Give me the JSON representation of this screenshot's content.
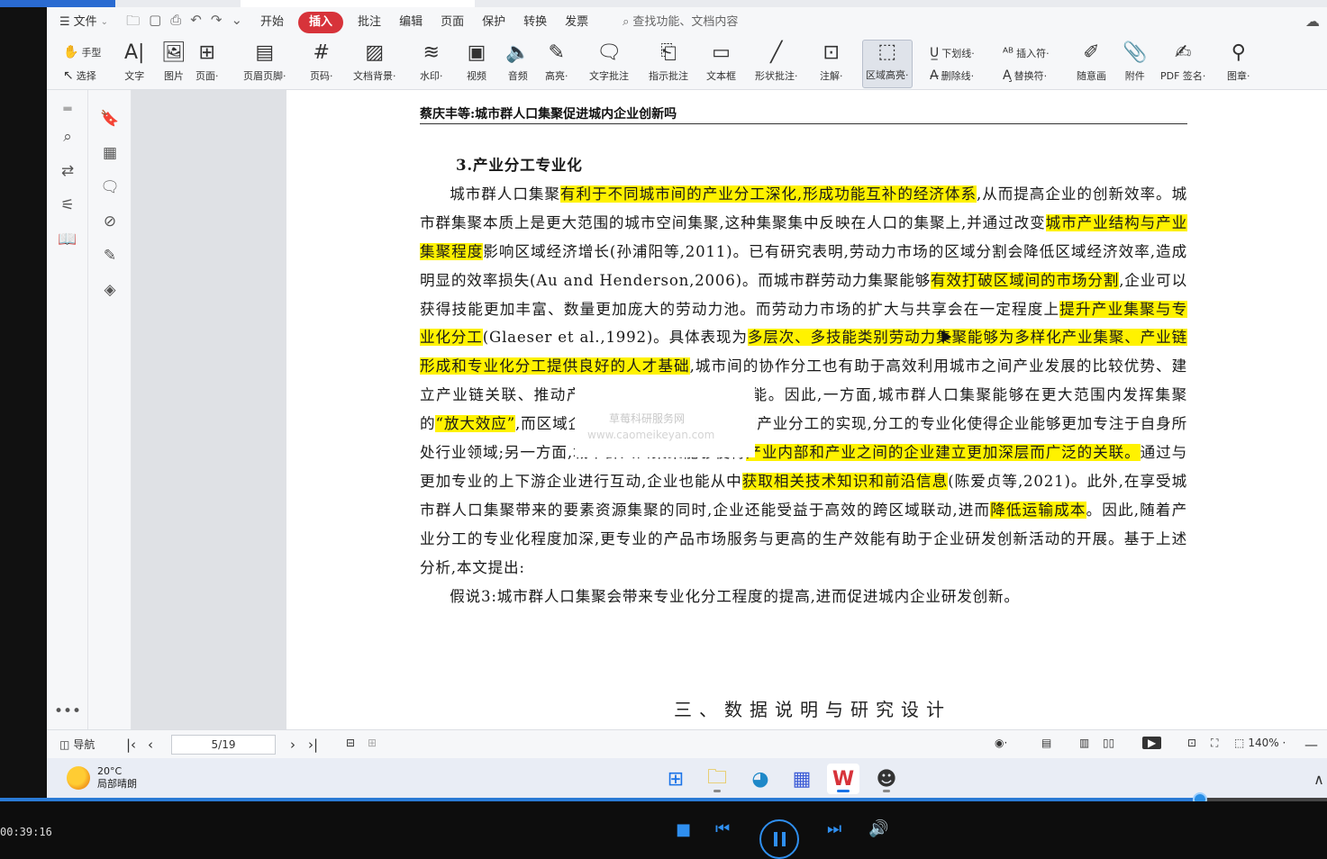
{
  "menubar": {
    "file": "文件",
    "tabs": [
      "开始",
      "插入",
      "批注",
      "编辑",
      "页面",
      "保护",
      "转换",
      "发票"
    ],
    "active_tab": "插入",
    "search_placeholder": "查找功能、文档内容"
  },
  "ribbon": {
    "hand": "手型",
    "select": "选择",
    "items": [
      {
        "label": "文字",
        "icon": "text-icon"
      },
      {
        "label": "图片",
        "icon": "image-icon"
      },
      {
        "label": "页面·",
        "icon": "page-icon"
      },
      {
        "label": "页眉页脚·",
        "icon": "header-footer-icon"
      },
      {
        "label": "页码·",
        "icon": "page-number-icon"
      },
      {
        "label": "文档背景·",
        "icon": "background-icon"
      },
      {
        "label": "水印·",
        "icon": "watermark-icon"
      },
      {
        "label": "视频",
        "icon": "video-icon"
      },
      {
        "label": "音频",
        "icon": "audio-icon"
      },
      {
        "label": "高亮·",
        "icon": "highlight-icon"
      },
      {
        "label": "文字批注",
        "icon": "text-comment-icon"
      },
      {
        "label": "指示批注",
        "icon": "pointer-comment-icon"
      },
      {
        "label": "文本框",
        "icon": "textbox-icon"
      },
      {
        "label": "形状批注·",
        "icon": "shape-comment-icon"
      },
      {
        "label": "注解·",
        "icon": "annotation-icon"
      },
      {
        "label": "区域高亮·",
        "icon": "area-highlight-icon"
      }
    ],
    "underline": "下划线·",
    "strikethrough": "删除线·",
    "insert_char": "插入符·",
    "replace_char": "替换符·",
    "freehand": "随意画",
    "attachment": "附件",
    "pdf_sign": "PDF 签名·",
    "stamp": "图章·"
  },
  "document": {
    "running_head": "蔡庆丰等:城市群人口集聚促进城内企业创新吗",
    "heading": "3.产业分工专业化",
    "section_title": "三、数据说明与研究设计",
    "watermark_cn": "草莓科研服务网",
    "watermark_url": "www.caomeikeyan.com"
  },
  "status": {
    "nav": "导航",
    "page": "5/19",
    "zoom": "140% ·"
  },
  "taskbar": {
    "temp": "20°C",
    "weather": "局部晴朗"
  },
  "player": {
    "time": "00:39:16",
    "progress_fraction": 0.904
  }
}
